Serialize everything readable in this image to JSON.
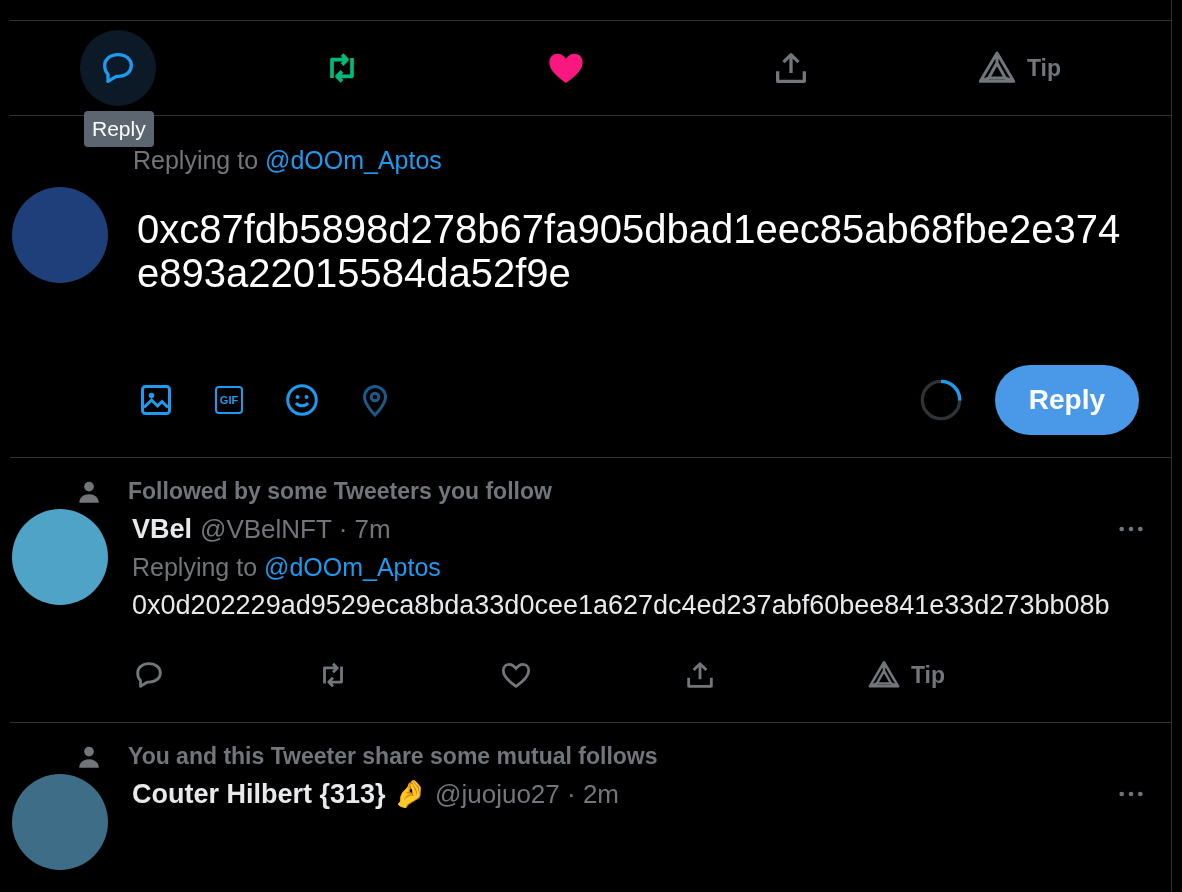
{
  "main_tweet_actions": [
    {
      "kind": "reply",
      "active": true,
      "hovered": true
    },
    {
      "kind": "retweet",
      "active": true,
      "hovered": false
    },
    {
      "kind": "like",
      "active": true,
      "hovered": false
    },
    {
      "kind": "share",
      "active": false,
      "hovered": false
    },
    {
      "kind": "tip",
      "active": false,
      "hovered": false,
      "label": "Tip"
    }
  ],
  "tooltip": "Reply",
  "composer": {
    "replying_prefix": "Replying to",
    "replying_handle": "@dOOm_Aptos",
    "value": "0xc87fdb5898d278b67fa905dbad1eec85ab68fbe2e374e893a22015584da52f9e",
    "tools": [
      {
        "kind": "image",
        "enabled": true
      },
      {
        "kind": "gif",
        "enabled": true,
        "label": "GIF"
      },
      {
        "kind": "emoji",
        "enabled": true
      },
      {
        "kind": "location",
        "enabled": false
      }
    ],
    "button": "Reply"
  },
  "replies": [
    {
      "context": "Followed by some Tweeters you follow",
      "name": "VBel",
      "handle_time": "@VBelNFT · 7m",
      "replying_prefix": "Replying to",
      "replying_handle": "@dOOm_Aptos",
      "text": "0x0d202229ad9529eca8bda33d0cee1a627dc4ed237abf60bee841e33d273bb08b",
      "actions": [
        {
          "kind": "reply",
          "active": false
        },
        {
          "kind": "retweet",
          "active": false
        },
        {
          "kind": "like",
          "active": false
        },
        {
          "kind": "share",
          "active": false
        },
        {
          "kind": "tip",
          "active": false,
          "label": "Tip"
        }
      ]
    },
    {
      "context": "You and this Tweeter share some mutual follows",
      "name": "Couter Hilbert {313} 🤌",
      "handle_time": "@juojuo27 · 2m"
    }
  ]
}
